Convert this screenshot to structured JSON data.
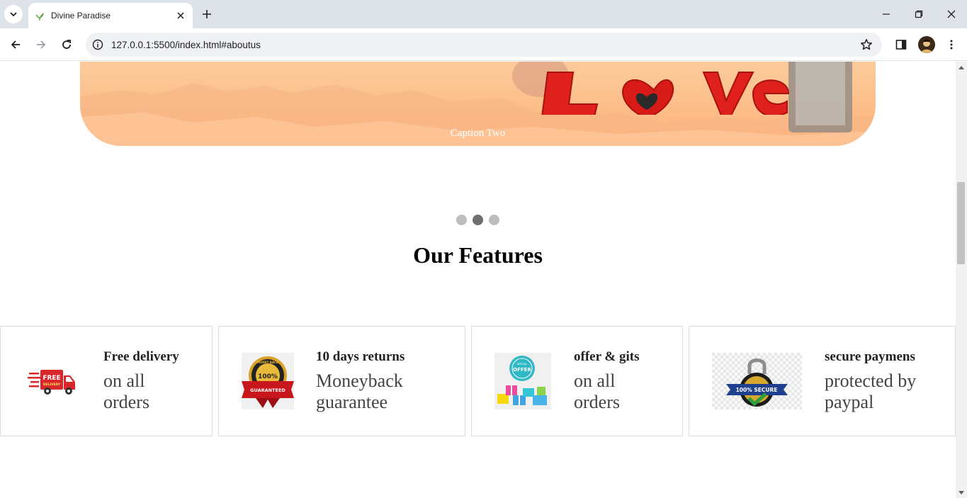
{
  "browser": {
    "tab_title": "Divine Paradise",
    "url": "127.0.0.1:5500/index.html#aboutus"
  },
  "carousel": {
    "caption": "Caption Two",
    "slide_text": "Love",
    "slide_count": 3,
    "active_index": 1
  },
  "features_section": {
    "title": "Our Features",
    "items": [
      {
        "heading": "Free delivery",
        "line1": "on all",
        "line2": "orders",
        "badge_text": "FREE",
        "badge_sub": "DELIVERY",
        "icon": "delivery-truck-icon"
      },
      {
        "heading": "10 days returns",
        "line1": "Moneyback",
        "line2": "guarantee",
        "badge_text": "100%",
        "badge_top": "MONEY BACK",
        "badge_ribbon": "GUARANTEED",
        "icon": "money-back-badge-icon"
      },
      {
        "heading": "offer & gits",
        "line1": "on all",
        "line2": "orders",
        "badge_text": "OFFER",
        "badge_top": "SPECIAL",
        "icon": "gift-offer-icon"
      },
      {
        "heading": "secure paymens",
        "line1": "protected by",
        "line2": "paypal",
        "badge_text": "100% SECURE",
        "icon": "secure-lock-icon"
      }
    ]
  },
  "colors": {
    "chrome_bg": "#dee3ea",
    "omnibox_bg": "#eff1f4",
    "dot_active": "#6f6f6f",
    "dot_inactive": "#bdbdbd"
  }
}
